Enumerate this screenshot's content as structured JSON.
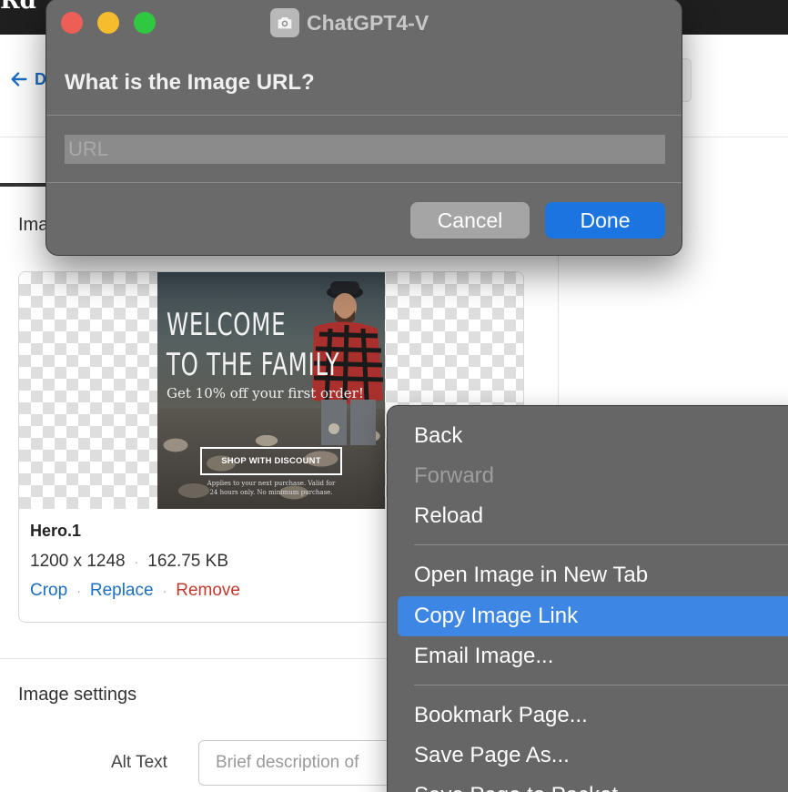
{
  "background": {
    "brand_partial": "Rd",
    "back_partial": "D",
    "section_heading_partial": "Ima",
    "image_card": {
      "hero": {
        "line1": "WELCOME",
        "line2": "TO THE FAMILY",
        "line3": "Get 10% off your first order!",
        "button": "SHOP WITH DISCOUNT",
        "fine_print": "Applies to your next purchase. Valid for 24 hours only. No minimum purchase."
      },
      "name": "Hero.1",
      "dimensions": "1200 x 1248",
      "size": "162.75 KB",
      "separator": "·",
      "actions": {
        "crop": "Crop",
        "replace": "Replace",
        "remove": "Remove"
      }
    },
    "settings_heading": "Image settings",
    "alt_text": {
      "label": "Alt Text",
      "placeholder": "Brief description of"
    }
  },
  "dialog": {
    "app_title": "ChatGPT4-V",
    "question": "What is the Image URL?",
    "url_placeholder": "URL",
    "cancel_label": "Cancel",
    "done_label": "Done"
  },
  "context_menu": {
    "items": [
      {
        "label": "Back"
      },
      {
        "label": "Forward",
        "disabled": true
      },
      {
        "label": "Reload"
      },
      {
        "label": "Open Image in New Tab"
      },
      {
        "label": "Copy Image Link",
        "highlighted": true
      },
      {
        "label": "Email Image..."
      },
      {
        "label": "Bookmark Page..."
      },
      {
        "label": "Save Page As..."
      },
      {
        "label": "Save Page to Pocket"
      }
    ]
  },
  "colors": {
    "link": "#1a6fc2",
    "remove": "#c0392b",
    "done_button": "#1c74e0",
    "menu_highlight": "#3d86e3"
  }
}
